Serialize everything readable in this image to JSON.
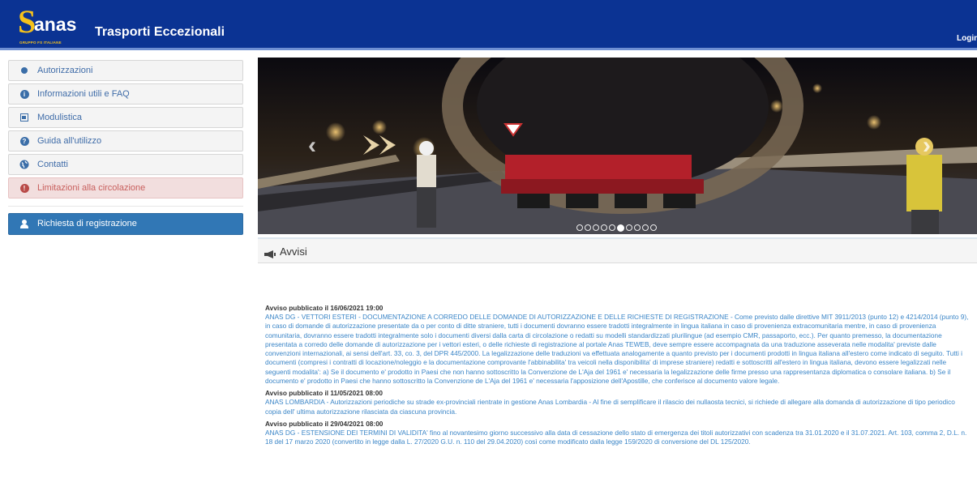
{
  "header": {
    "logo_text": "anas",
    "logo_subtext": "GRUPPO FS ITALIANE",
    "app_title": "Trasporti Eccezionali",
    "login_label": "Login"
  },
  "sidebar": {
    "items": [
      {
        "label": "Autorizzazioni",
        "icon": "dot-icon"
      },
      {
        "label": "Informazioni utili e FAQ",
        "icon": "info-icon"
      },
      {
        "label": "Modulistica",
        "icon": "form-icon"
      },
      {
        "label": "Guida all'utilizzo",
        "icon": "question-icon"
      },
      {
        "label": "Contatti",
        "icon": "globe-icon"
      },
      {
        "label": "Limitazioni alla circolazione",
        "icon": "exclamation-icon"
      }
    ],
    "register_label": "Richiesta di registrazione"
  },
  "carousel": {
    "prev_glyph": "‹",
    "next_glyph": "›",
    "slide_count": 10,
    "active_index": 5
  },
  "notices_panel": {
    "title": "Avvisi",
    "items": [
      {
        "title": "Avviso pubblicato il 16/06/2021 19:00",
        "body": "ANAS DG - VETTORI ESTERI - DOCUMENTAZIONE A CORREDO DELLE DOMANDE DI AUTORIZZAZIONE E DELLE RICHIESTE DI REGISTRAZIONE - Come previsto dalle direttive MIT 3911/2013 (punto 12) e 4214/2014 (punto 9), in caso di domande di autorizzazione presentate da o per conto di ditte straniere, tutti i documenti dovranno essere tradotti integralmente in lingua italiana in caso di provenienza extracomunitaria mentre, in caso di provenienza comunitaria, dovranno essere tradotti integralmente solo i documenti diversi dalla carta di circolazione o redatti su modelli standardizzati plurilingue (ad esempio CMR, passaporto, ecc.). Per quanto premesso, la documentazione presentata a corredo delle domande di autorizzazione per i vettori esteri, o delle richieste di registrazione al portale Anas TEWEB, deve sempre essere accompagnata da una traduzione asseverata nelle modalita' previste dalle convenzioni internazionali, ai sensi dell'art. 33, co. 3, del DPR 445/2000. La legalizzazione delle traduzioni va effettuata analogamente a quanto previsto per i documenti prodotti in lingua italiana all'estero come indicato di seguito. Tutti i documenti (compresi i contratti di locazione/noleggio e la documentazione comprovante l'abbinabilita' tra veicoli nella disponibilita' di imprese straniere) redatti e sottoscritti all'estero in lingua italiana, devono essere legalizzati nelle seguenti modalita': a) Se il documento e' prodotto in Paesi che non hanno sottoscritto la Convenzione de L'Aja del 1961 e' necessaria la legalizzazione delle firme presso una rappresentanza diplomatica o consolare italiana. b) Se il documento e' prodotto in Paesi che hanno sottoscritto la Convenzione de L'Aja del 1961 e' necessaria l'apposizione dell'Apostille, che conferisce al documento valore legale."
      },
      {
        "title": "Avviso pubblicato il 11/05/2021 08:00",
        "body": "ANAS LOMBARDIA - Autorizzazioni periodiche su strade ex-provinciali rientrate in gestione Anas Lombardia - Al fine di semplificare il rilascio dei nullaosta tecnici, si richiede di allegare alla domanda di autorizzazione di tipo periodico copia dell' ultima autorizzazione rilasciata da ciascuna provincia."
      },
      {
        "title": "Avviso pubblicato il 29/04/2021 08:00",
        "body": "ANAS DG - ESTENSIONE DEI TERMINI DI VALIDITA' fino al novantesimo giorno successivo alla data di cessazione dello stato di emergenza dei titoli autorizzativi con scadenza tra 31.01.2020 e il 31.07.2021. Art. 103, comma 2, D.L. n. 18 del 17 marzo 2020 (convertito in legge dalla L. 27/2020 G.U. n. 110 del 29.04.2020) così come modificato dalla legge 159/2020 di conversione del DL 125/2020."
      }
    ]
  },
  "colors": {
    "header_bg": "#0b3393",
    "logo_yellow": "#f6c21b",
    "link_blue": "#3a85c7",
    "danger_bg": "#f2dede",
    "danger_text": "#c85f5d",
    "button_blue": "#3177b5"
  }
}
